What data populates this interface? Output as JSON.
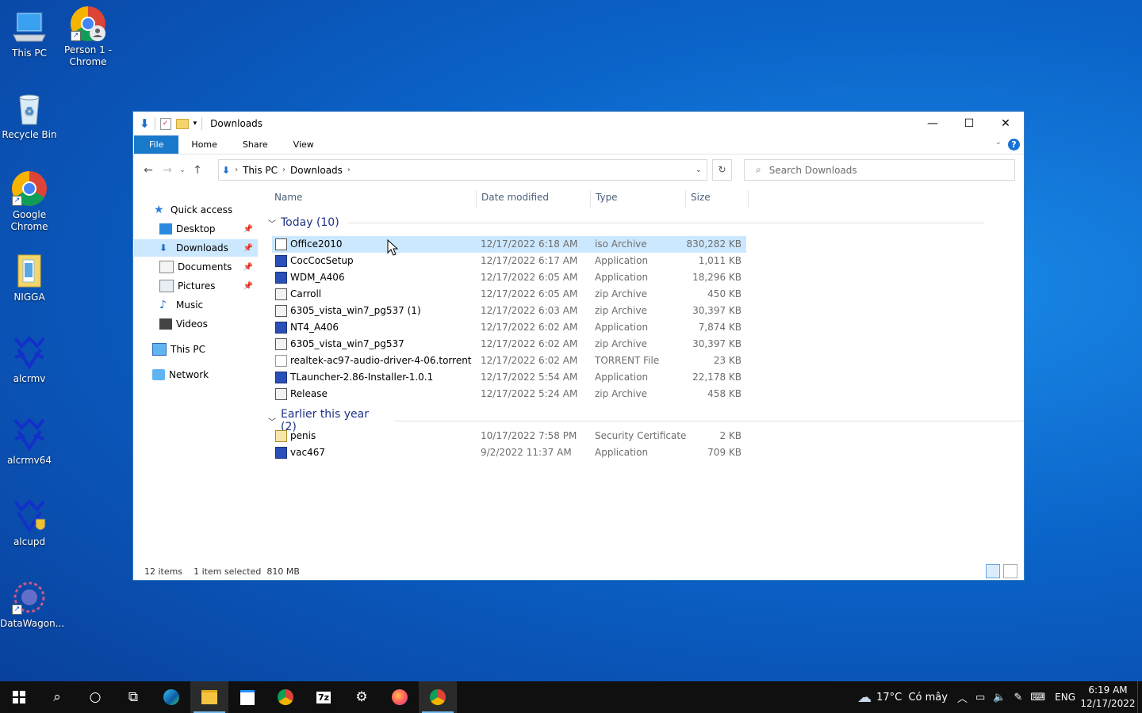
{
  "desktop": {
    "icons": [
      {
        "label": "This PC",
        "icon": "computer-icon"
      },
      {
        "label": "Person 1 - Chrome",
        "icon": "chrome-profile-icon"
      },
      {
        "label": "Recycle Bin",
        "icon": "recycle-bin-icon"
      },
      {
        "label": "Google Chrome",
        "icon": "chrome-icon"
      },
      {
        "label": "NIGGA",
        "icon": "folder-icon"
      },
      {
        "label": "alcrmv",
        "icon": "realtek-icon"
      },
      {
        "label": "alcrmv64",
        "icon": "realtek-icon"
      },
      {
        "label": "alcupd",
        "icon": "realtek-shield-icon"
      },
      {
        "label": "DataWagon...",
        "icon": "datawagon-icon"
      }
    ]
  },
  "window": {
    "title": "Downloads",
    "ribbon_tabs": [
      "File",
      "Home",
      "Share",
      "View"
    ],
    "address": [
      "This PC",
      "Downloads"
    ],
    "search_placeholder": "Search Downloads",
    "nav": {
      "quick_access": "Quick access",
      "items": [
        "Desktop",
        "Downloads",
        "Documents",
        "Pictures",
        "Music",
        "Videos"
      ],
      "this_pc": "This PC",
      "network": "Network"
    },
    "columns": {
      "name": "Name",
      "date": "Date modified",
      "type": "Type",
      "size": "Size"
    },
    "groups": [
      {
        "title": "Today (10)",
        "files": [
          {
            "name": "Office2010",
            "date": "12/17/2022 6:18 AM",
            "type": "iso Archive",
            "size": "830,282 KB",
            "selected": true
          },
          {
            "name": "CocCocSetup",
            "date": "12/17/2022 6:17 AM",
            "type": "Application",
            "size": "1,011 KB"
          },
          {
            "name": "WDM_A406",
            "date": "12/17/2022 6:05 AM",
            "type": "Application",
            "size": "18,296 KB"
          },
          {
            "name": "Carroll",
            "date": "12/17/2022 6:05 AM",
            "type": "zip Archive",
            "size": "450 KB"
          },
          {
            "name": "6305_vista_win7_pg537 (1)",
            "date": "12/17/2022 6:03 AM",
            "type": "zip Archive",
            "size": "30,397 KB"
          },
          {
            "name": "NT4_A406",
            "date": "12/17/2022 6:02 AM",
            "type": "Application",
            "size": "7,874 KB"
          },
          {
            "name": "6305_vista_win7_pg537",
            "date": "12/17/2022 6:02 AM",
            "type": "zip Archive",
            "size": "30,397 KB"
          },
          {
            "name": "realtek-ac97-audio-driver-4-06.torrent",
            "date": "12/17/2022 6:02 AM",
            "type": "TORRENT File",
            "size": "23 KB"
          },
          {
            "name": "TLauncher-2.86-Installer-1.0.1",
            "date": "12/17/2022 5:54 AM",
            "type": "Application",
            "size": "22,178 KB"
          },
          {
            "name": "Release",
            "date": "12/17/2022 5:24 AM",
            "type": "zip Archive",
            "size": "458 KB"
          }
        ]
      },
      {
        "title": "Earlier this year (2)",
        "files": [
          {
            "name": "penis",
            "date": "10/17/2022 7:58 PM",
            "type": "Security Certificate",
            "size": "2 KB"
          },
          {
            "name": "vac467",
            "date": "9/2/2022 11:37 AM",
            "type": "Application",
            "size": "709 KB"
          }
        ]
      }
    ],
    "status": {
      "count": "12 items",
      "selection": "1 item selected  810 MB"
    }
  },
  "taskbar": {
    "weather": "17°C  Có mây",
    "language": "ENG",
    "time": "6:19 AM",
    "date": "12/17/2022"
  },
  "colors": {
    "accent": "#1979ca",
    "selection": "#cce8ff",
    "taskbar": "#101010"
  }
}
